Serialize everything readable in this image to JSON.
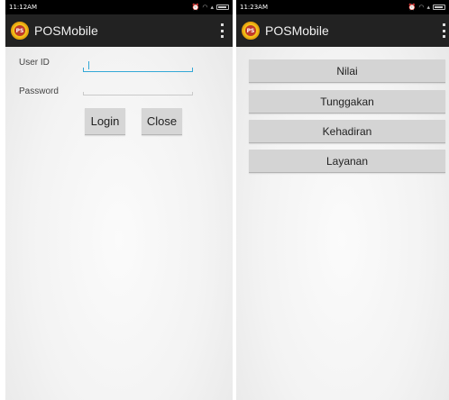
{
  "left_screen": {
    "status": {
      "time": "11:12AM"
    },
    "app_title": "POSMobile",
    "logo_text": "PS",
    "form": {
      "user_id_label": "User ID",
      "user_id_value": "",
      "password_label": "Password",
      "password_value": "",
      "login_label": "Login",
      "close_label": "Close"
    }
  },
  "right_screen": {
    "status": {
      "time": "11:23AM"
    },
    "app_title": "POSMobile",
    "logo_text": "PS",
    "menu": [
      {
        "label": "Nilai"
      },
      {
        "label": "Tunggakan"
      },
      {
        "label": "Kehadiran"
      },
      {
        "label": "Layanan"
      }
    ]
  },
  "icons": {
    "status_icons": [
      "alarm-icon",
      "wifi-icon",
      "signal-icon",
      "battery-icon"
    ],
    "overflow": "overflow-menu-icon"
  },
  "colors": {
    "action_bar": "#222222",
    "focus_line": "#33a8d6",
    "button_bg": "#d6d6d6"
  }
}
